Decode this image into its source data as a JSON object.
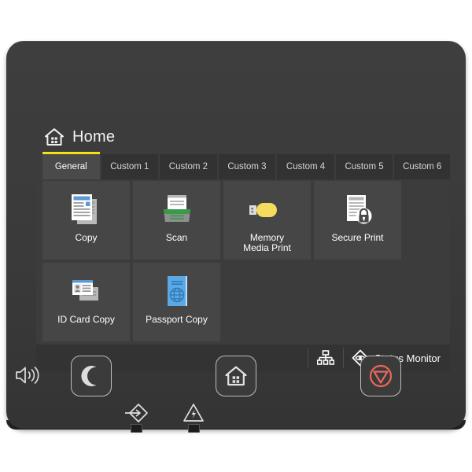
{
  "device": {
    "name": "printer-control-panel",
    "bezel_color": "#3a3a3a",
    "screen_bg": "#3c3c3c"
  },
  "screen": {
    "header": {
      "title": "Home",
      "icon": "home-icon"
    },
    "tabs": [
      {
        "label": "General",
        "active": true
      },
      {
        "label": "Custom 1",
        "active": false
      },
      {
        "label": "Custom 2",
        "active": false
      },
      {
        "label": "Custom 3",
        "active": false
      },
      {
        "label": "Custom 4",
        "active": false
      },
      {
        "label": "Custom 5",
        "active": false
      },
      {
        "label": "Custom 6",
        "active": false
      }
    ],
    "active_tab_accent": "#f2e216",
    "tiles": [
      {
        "label": "Copy",
        "icon": "copy-documents-icon"
      },
      {
        "label": "Scan",
        "icon": "scanner-icon"
      },
      {
        "label": "Memory\nMedia Print",
        "label_line1": "Memory",
        "label_line2": "Media Print",
        "icon": "usb-drive-icon"
      },
      {
        "label": "Secure Print",
        "icon": "document-lock-icon"
      },
      {
        "label": "ID Card Copy",
        "icon": "id-card-icon"
      },
      {
        "label": "Passport Copy",
        "icon": "passport-icon"
      }
    ],
    "status_bar": {
      "network_icon": "network-lan-icon",
      "status_monitor_icon": "status-monitor-eye-icon",
      "status_monitor_label": "Status Monitor"
    }
  },
  "hardware": {
    "speaker_icon": "speaker-volume-icon",
    "buttons": [
      {
        "name": "sleep-button",
        "icon": "moon-icon"
      },
      {
        "name": "home-button",
        "icon": "home-house-icon"
      },
      {
        "name": "stop-button",
        "icon": "stop-icon",
        "color": "#e8685a"
      }
    ],
    "indicators": [
      {
        "name": "data-indicator",
        "icon": "data-transfer-icon"
      },
      {
        "name": "error-indicator",
        "icon": "warning-triangle-icon"
      }
    ]
  },
  "colors": {
    "accent_yellow": "#f2e216",
    "tile_bg": "#464646",
    "tab_inactive_bg": "#323232",
    "tab_active_bg": "#4a4a4a",
    "status_bar_bg": "#333333",
    "stop_red": "#e8685a",
    "copy_blue": "#5b9bd5",
    "scan_green": "#3a9a4a",
    "usb_yellow": "#f5dc5f",
    "passport_blue": "#5aa9e6"
  }
}
